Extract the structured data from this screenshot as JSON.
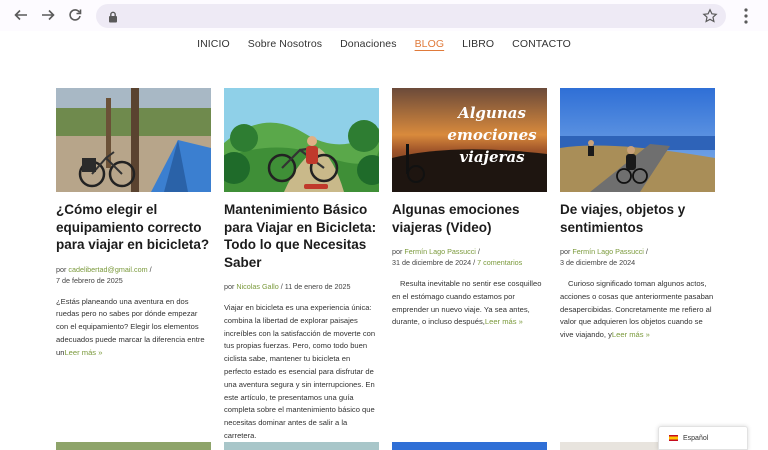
{
  "nav": {
    "items": [
      {
        "label": "INICIO",
        "active": false
      },
      {
        "label": "Sobre Nosotros",
        "active": false
      },
      {
        "label": "Donaciones",
        "active": false
      },
      {
        "label": "BLOG",
        "active": true
      },
      {
        "label": "LIBRO",
        "active": false
      },
      {
        "label": "CONTACTO",
        "active": false
      }
    ]
  },
  "posts": [
    {
      "title": "¿Cómo elegir el equipamiento correcto para viajar en bicicleta?",
      "by": "por",
      "author": "cadelibertad@gmail.com",
      "sep": "/",
      "date": "7 de febrero de 2025",
      "comments": "",
      "excerpt": "¿Estás planeando una aventura en dos ruedas pero no sabes por dónde empezar con el equipamiento? Elegir los elementos adecuados puede marcar la diferencia entre un",
      "more": "Leer más »"
    },
    {
      "title": "Mantenimiento Básico para Viajar en Bicicleta: Todo lo que Necesitas Saber",
      "by": "por",
      "author": "Nicolas Gallo",
      "sep": "/",
      "date": "11 de enero de 2025",
      "comments": "",
      "excerpt": "Viajar en bicicleta es una experiencia única: combina la libertad de explorar paisajes increíbles con la satisfacción de moverte con tus propias fuerzas. Pero, como todo buen ciclista sabe, mantener tu bicicleta en perfecto estado es esencial para disfrutar de una aventura segura y sin interrupciones. En este artículo, te presentamos una guía completa sobre el mantenimiento básico que necesitas dominar antes de salir a la carretera.",
      "more": ""
    },
    {
      "title": "Algunas emociones viajeras (Video)",
      "by": "por",
      "author": "Fermín Lago Passucci",
      "sep": "/",
      "date": "31 de diciembre de 2024",
      "comments": "7 comentarios",
      "excerpt": "Resulta inevitable no sentir ese cosquilleo en el estómago cuando estamos por emprender un nuevo viaje. Ya sea antes, durante, o incluso después,",
      "more": "Leer más »",
      "image_text": [
        "Algunas",
        "emociones",
        "viajeras"
      ]
    },
    {
      "title": "De viajes, objetos y sentimientos",
      "by": "por",
      "author": "Fermín Lago Passucci",
      "sep": "/",
      "date": "3 de diciembre de 2024",
      "comments": "",
      "excerpt": "Curioso significado toman algunos actos, acciones o cosas que anteriormente pasaban desapercibidas. Concretamente me refiero al valor que adquieren los objetos cuando se vive viajando, y",
      "more": "Leer más »"
    }
  ],
  "language": {
    "label": "Español"
  },
  "colors": {
    "accent": "#e07a3a",
    "link": "#7b9a3c"
  }
}
